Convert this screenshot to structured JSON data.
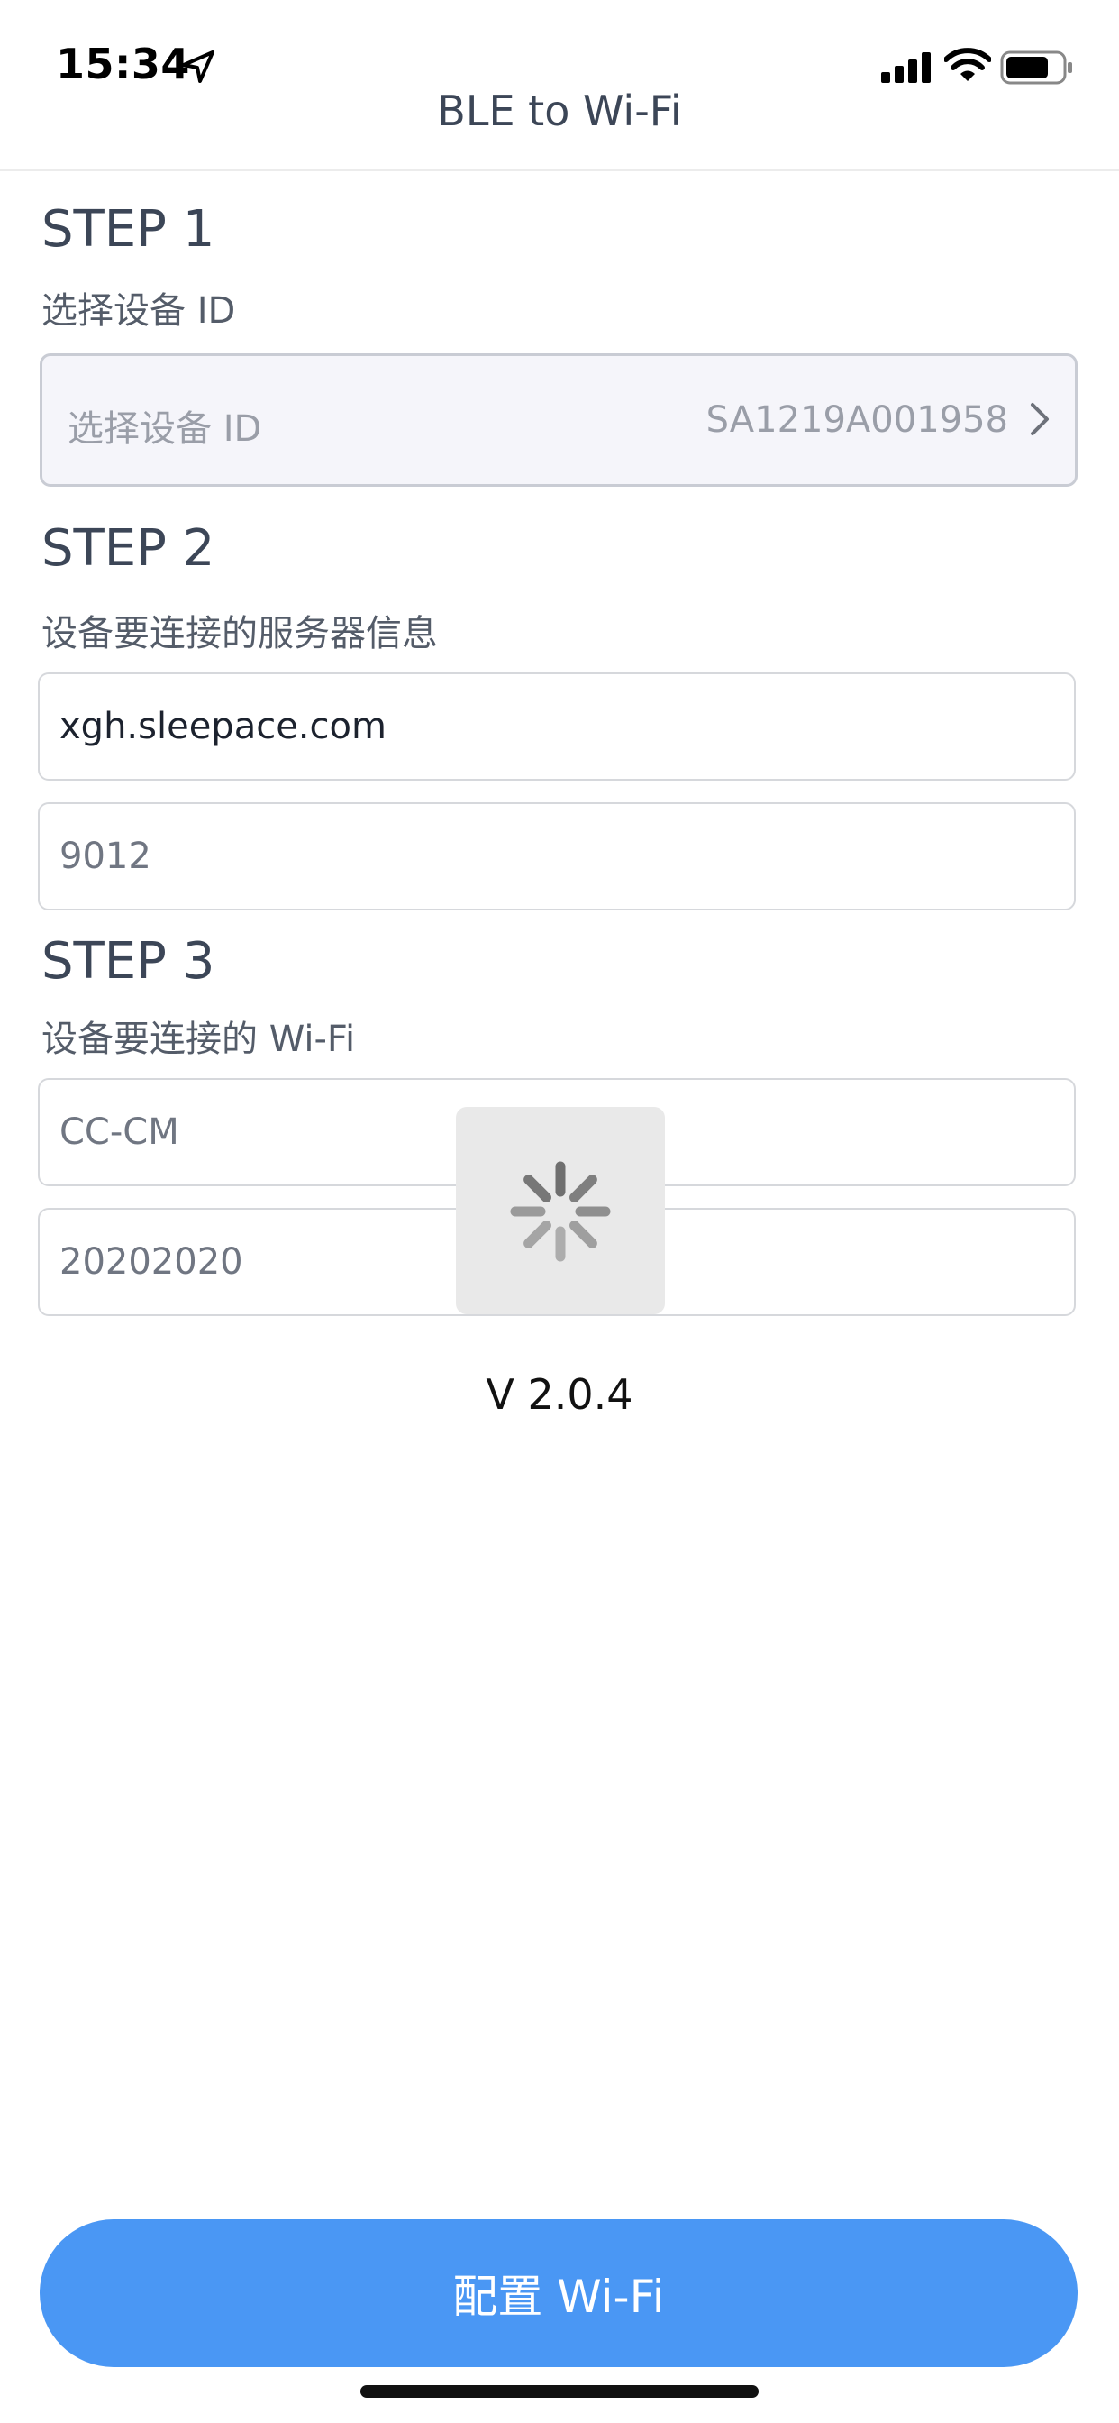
{
  "status_bar": {
    "time": "15:34",
    "icons": [
      "location-arrow-icon",
      "cellular-signal-icon",
      "wifi-icon",
      "battery-icon"
    ]
  },
  "nav": {
    "title": "BLE to Wi-Fi"
  },
  "step1": {
    "title": "STEP 1",
    "subtitle": "选择设备 ID",
    "select_placeholder": "选择设备 ID",
    "select_value": "SA1219A001958"
  },
  "step2": {
    "title": "STEP 2",
    "subtitle": "设备要连接的服务器信息",
    "server_value": "xgh.sleepace.com",
    "port_value": "9012"
  },
  "step3": {
    "title": "STEP 3",
    "subtitle": "设备要连接的 Wi-Fi",
    "ssid_value": "CC-CM",
    "password_value": "20202020"
  },
  "version": "V 2.0.4",
  "config_button": {
    "label": "配置 Wi-Fi"
  },
  "colors": {
    "accent": "#4A97F4",
    "text": "#3C4657",
    "border": "#D6D8DC",
    "select_background": "#F5F5FA",
    "overlay": "#E9E9E9"
  }
}
